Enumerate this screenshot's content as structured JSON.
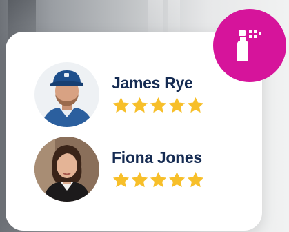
{
  "colors": {
    "brand_pink": "#d6149b",
    "name_navy": "#152b52",
    "star_yellow": "#f7bf2a",
    "card_bg": "#ffffff"
  },
  "badge": {
    "icon": "spray-bottle-icon"
  },
  "reviews": [
    {
      "name": "James Rye",
      "rating": 5,
      "max_rating": 5,
      "avatar": "avatar-man-cap-icon"
    },
    {
      "name": "Fiona Jones",
      "rating": 5,
      "max_rating": 5,
      "avatar": "avatar-woman-icon"
    }
  ]
}
